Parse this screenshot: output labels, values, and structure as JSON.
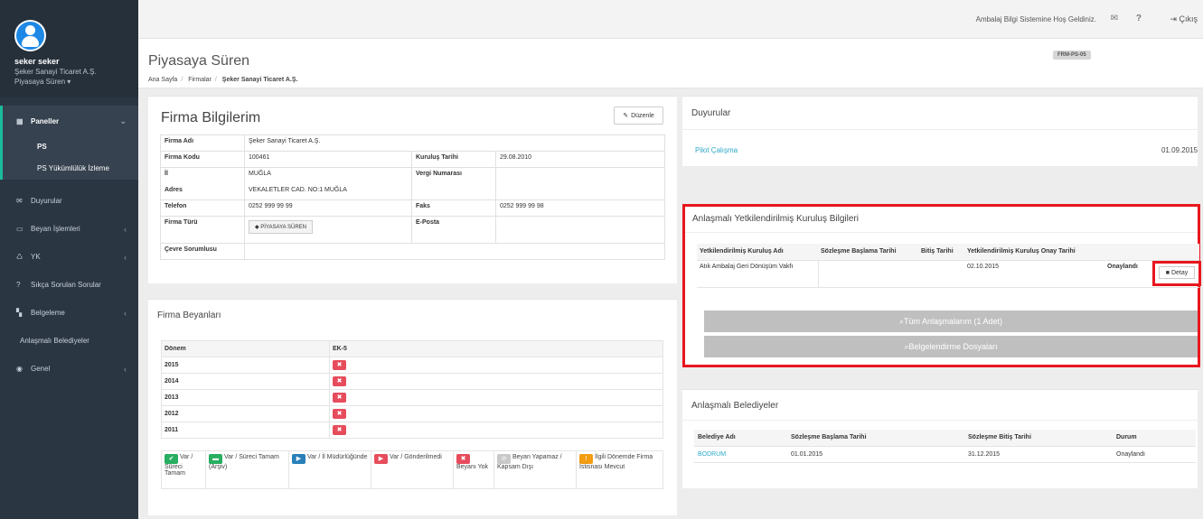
{
  "sidebar": {
    "user": {
      "name": "seker seker",
      "company": "Şeker Sanayi Ticaret A.Ş.",
      "role": "Piyasaya Süren ▾"
    },
    "paneller": "Paneller",
    "sub_items": [
      "PS",
      "PS Yükümlülük İzleme"
    ],
    "items": [
      {
        "label": "Duyurular",
        "icon": "envelope-icon"
      },
      {
        "label": "Beyan İşlemleri",
        "icon": "monitor-icon"
      },
      {
        "label": "YK",
        "icon": "recycle-icon"
      },
      {
        "label": "Sıkça Sorulan Sorular",
        "icon": "question-icon"
      },
      {
        "label": "Belgeleme",
        "icon": "document-icon"
      }
    ],
    "plain_item": "Anlaşmalı Belediyeler",
    "genel": "Genel"
  },
  "topbar": {
    "welcome": "Ambalaj Bilgi Sistemine Hoş Geldiniz.",
    "logout": "Çıkış"
  },
  "page": {
    "title": "Piyasaya Süren",
    "breadcrumb": [
      "Ana Sayfa",
      "Firmalar",
      "Şeker Sanayi Ticaret A.Ş."
    ],
    "form_code": "FRM-PS-05"
  },
  "firma": {
    "title": "Firma Bilgilerim",
    "edit_label": "Düzenle",
    "labels": {
      "firma_adi": "Firma Adı",
      "firma_kodu": "Firma Kodu",
      "il": "İl",
      "adres": "Adres",
      "telefon": "Telefon",
      "firma_turu": "Firma Türü",
      "cevre": "Çevre Sorumlusu",
      "kurulus_tarihi": "Kuruluş Tarihi",
      "vergi": "Vergi Numarası",
      "faks": "Faks",
      "eposta": "E-Posta"
    },
    "values": {
      "firma_adi": "Şeker Sanayi Ticaret A.Ş.",
      "firma_kodu": "100461",
      "il": "MUĞLA",
      "adres": "VEKALETLER CAD. NO:1 MUĞLA",
      "telefon": "0252 999 99 99",
      "firma_turu": "PİYASAYA SÜREN",
      "kurulus_tarihi": "29.08.2010",
      "faks": "0252 999 99 98"
    }
  },
  "beyan": {
    "title": "Firma Beyanları",
    "col_donem": "Dönem",
    "col_ek": "EK-5",
    "years": [
      "2015",
      "2014",
      "2013",
      "2012",
      "2011"
    ],
    "legend": [
      {
        "label": "Var / Süreci Tamam",
        "color": "#27ae60",
        "glyph": "✔"
      },
      {
        "label": "Var / Süreci Tamam (Arşiv)",
        "color": "#27ae60",
        "glyph": "▬"
      },
      {
        "label": "Var / İl Müdürlüğünde",
        "color": "#2980b9",
        "glyph": "▶"
      },
      {
        "label": "Var / Gönderilmedi",
        "color": "#e74c5c",
        "glyph": "▶"
      },
      {
        "label": "Beyanı Yok",
        "color": "#e74c5c",
        "glyph": "✖"
      },
      {
        "label": "Beyan Yapamaz / Kapsam Dışı",
        "color": "#c8c8c8",
        "glyph": "⊘"
      },
      {
        "label": "İlgili Dönemde Firma İstisnası Mevcut",
        "color": "#f39c12",
        "glyph": "!"
      }
    ]
  },
  "duyurular": {
    "title": "Duyurular",
    "link": "Pilot Çalışma",
    "date": "01.09.2015"
  },
  "kurulus": {
    "title": "Anlaşmalı Yetkilendirilmiş Kuruluş Bilgileri",
    "headers": [
      "Yetkilendirilmiş Kuruluş Adı",
      "Sözleşme Başlama Tarihi",
      "Bitiş Tarihi",
      "Yetkilendirilmiş Kuruluş Onay Tarihi",
      ""
    ],
    "row": {
      "name": "Atık Ambalaj Geri Dönüşüm Vakfı",
      "start": "",
      "end": "",
      "onay_tarihi": "02.10.2015",
      "status": "Onaylandı"
    },
    "detay_label": "Detay",
    "btn_all": "Tüm Anlaşmalarım (1 Adet)",
    "btn_belge": "Belgelendirme Dosyaları"
  },
  "belediyeler": {
    "title": "Anlaşmalı Belediyeler",
    "headers": [
      "Belediye Adı",
      "Sözleşme Başlama Tarihi",
      "Sözleşme Bitiş Tarihi",
      "Durum"
    ],
    "row": {
      "name": "BODRUM",
      "start": "01.01.2015",
      "end": "31.12.2015",
      "status": "Onaylandı"
    }
  }
}
